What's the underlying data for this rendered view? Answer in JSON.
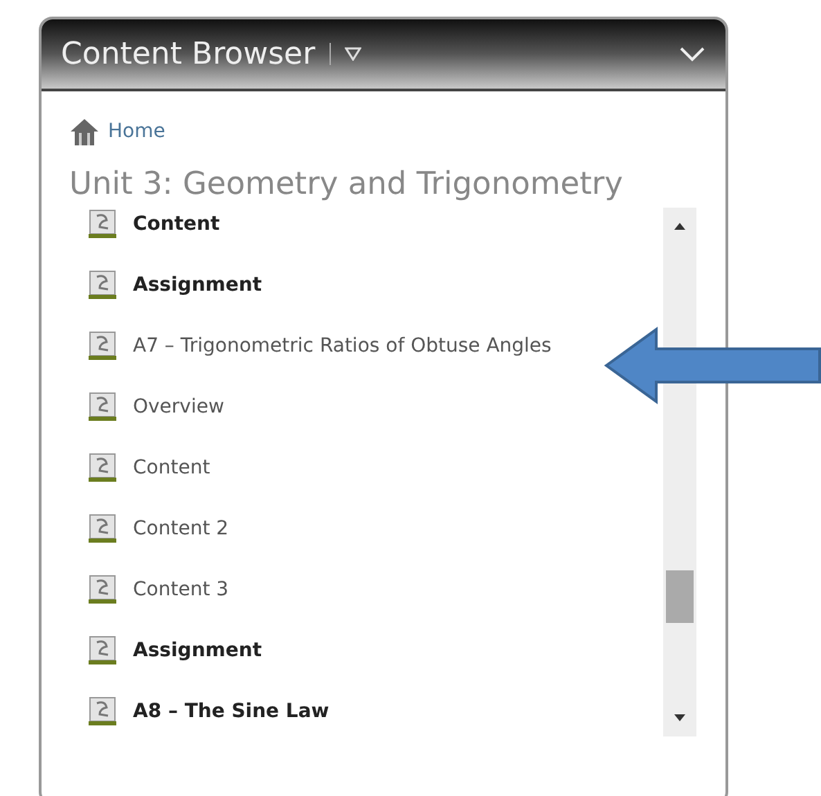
{
  "panel": {
    "title": "Content Browser"
  },
  "breadcrumb": {
    "label": "Home"
  },
  "unit_title": "Unit 3: Geometry and Trigonometry",
  "items": [
    {
      "label": "Content",
      "kind": "module"
    },
    {
      "label": "Assignment",
      "kind": "module"
    },
    {
      "label": "A7 – Trigonometric Ratios of Obtuse Angles",
      "kind": "topic"
    },
    {
      "label": "Overview",
      "kind": "topic"
    },
    {
      "label": "Content",
      "kind": "topic"
    },
    {
      "label": "Content 2",
      "kind": "topic"
    },
    {
      "label": "Content 3",
      "kind": "topic"
    },
    {
      "label": "Assignment",
      "kind": "module"
    },
    {
      "label": "A8 – The Sine Law",
      "kind": "module"
    }
  ]
}
